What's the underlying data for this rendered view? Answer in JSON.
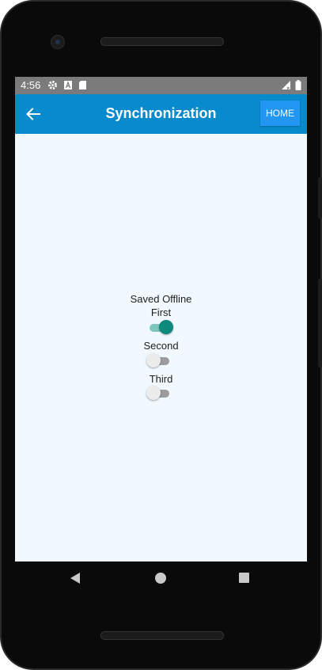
{
  "status_bar": {
    "time": "4:56",
    "left_icons": [
      "gear-icon",
      "a-icon",
      "sd-card-icon"
    ],
    "right_icons": [
      "signal-icon",
      "battery-icon"
    ]
  },
  "app_bar": {
    "title": "Synchronization",
    "home_label": "HOME",
    "background_color": "#088bcc",
    "home_button_color": "#2196f3"
  },
  "content": {
    "section_label": "Saved Offline",
    "toggles": [
      {
        "label": "First",
        "checked": true
      },
      {
        "label": "Second",
        "checked": false
      },
      {
        "label": "Third",
        "checked": false
      }
    ],
    "accent_color": "#0e8a7c"
  },
  "nav_bar": {
    "buttons": [
      "back-triangle-icon",
      "home-circle-icon",
      "recent-square-icon"
    ]
  }
}
